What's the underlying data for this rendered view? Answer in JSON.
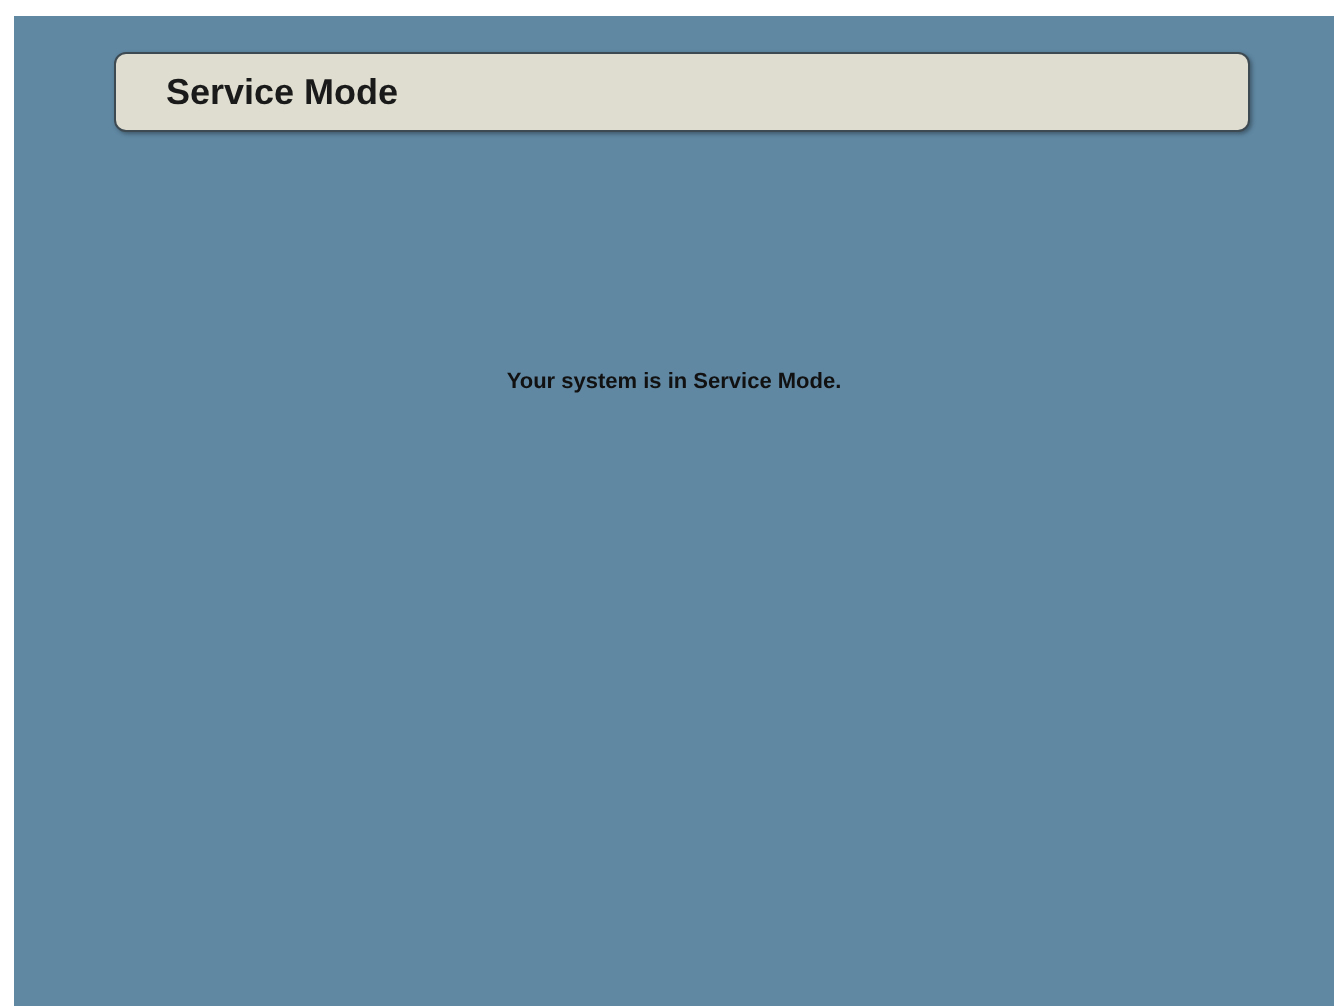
{
  "title_bar": {
    "title": "Service Mode"
  },
  "message": "Your system is in Service Mode."
}
